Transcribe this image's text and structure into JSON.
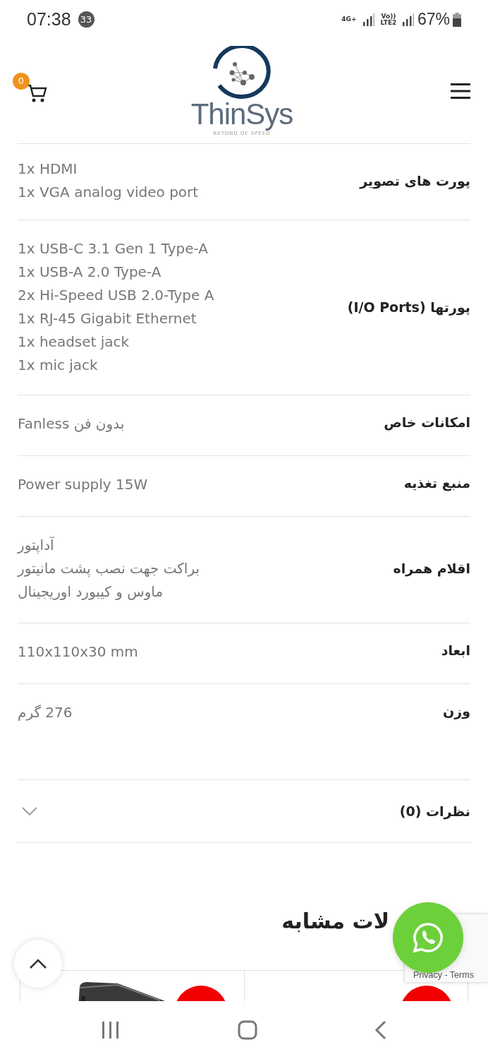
{
  "status_bar": {
    "time": "07:38",
    "notification_count": "33",
    "network_type": "4G+",
    "volte_label": "Vo)) LTE2",
    "battery": "67%"
  },
  "header": {
    "logo_text": "ThinSys",
    "logo_tagline": "BEYOND OF SPEED",
    "cart_count": "0"
  },
  "specs": [
    {
      "label": "پورت های تصویر",
      "values": [
        "1x HDMI",
        "1x VGA analog video port"
      ]
    },
    {
      "label": "پورتها (I/O Ports)",
      "values": [
        "1x USB-C 3.1 Gen 1 Type-A",
        "1x USB-A 2.0 Type-A",
        "2x Hi-Speed USB 2.0-Type A",
        "1x RJ-45 Gigabit Ethernet",
        "1x headset jack",
        "1x mic jack"
      ]
    },
    {
      "label": "امکانات خاص",
      "values": [
        "بدون فن Fanless"
      ]
    },
    {
      "label": "منبع تغذیه",
      "values": [
        "Power supply 15W"
      ]
    },
    {
      "label": "اقلام همراه",
      "values": [
        "آداپتور",
        "براکت جهت نصب پشت مانیتور",
        "ماوس و کیبورد اوریجینال"
      ]
    },
    {
      "label": "ابعاد",
      "values": [
        "110x110x30 mm"
      ]
    },
    {
      "label": "وزن",
      "values": [
        "276 گرم"
      ]
    }
  ],
  "reviews": {
    "label": "نظرات (0)",
    "expanded": false
  },
  "related": {
    "title": "لات مشابه"
  },
  "recaptcha": {
    "links": "Privacy - Terms"
  }
}
